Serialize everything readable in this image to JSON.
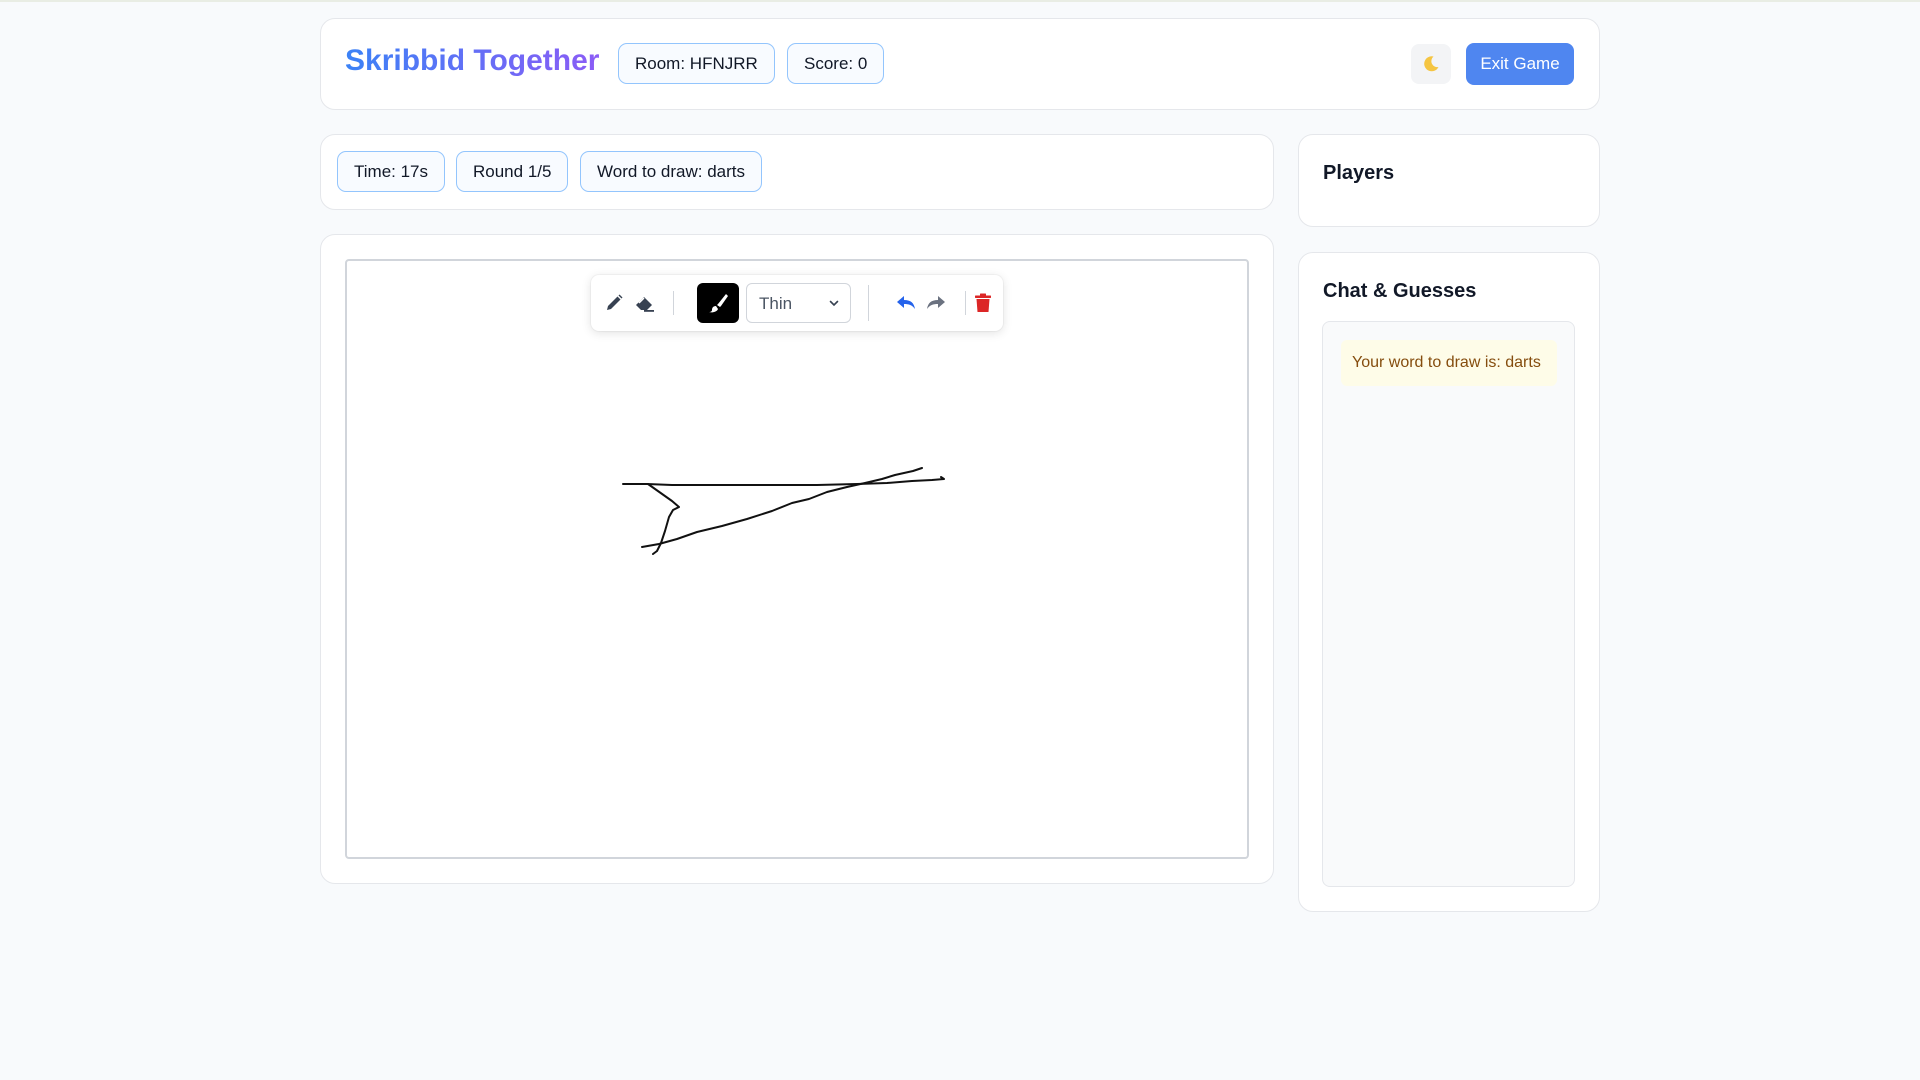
{
  "header": {
    "brand": "Skribbid Together",
    "room": "Room: HFNJRR",
    "score": "Score: 0",
    "theme_icon": "moon-icon",
    "exit_label": "Exit Game"
  },
  "status": {
    "time": "Time: 17s",
    "round": "Round 1/5",
    "word": "Word to draw: darts"
  },
  "toolbar": {
    "tools": [
      "pencil-icon",
      "eraser-icon",
      "brush-icon",
      "undo-icon",
      "redo-icon",
      "trash-icon"
    ],
    "brush_color": "#000000",
    "size_selected": "Thin"
  },
  "players": {
    "title": "Players"
  },
  "chat": {
    "title": "Chat & Guesses",
    "messages": [
      {
        "text": "Your word to draw is: darts"
      }
    ]
  },
  "colors": {
    "accent": "#4f86f0",
    "pill_border": "#93c5fd",
    "trash": "#dc2626",
    "undo": "#2563eb"
  }
}
